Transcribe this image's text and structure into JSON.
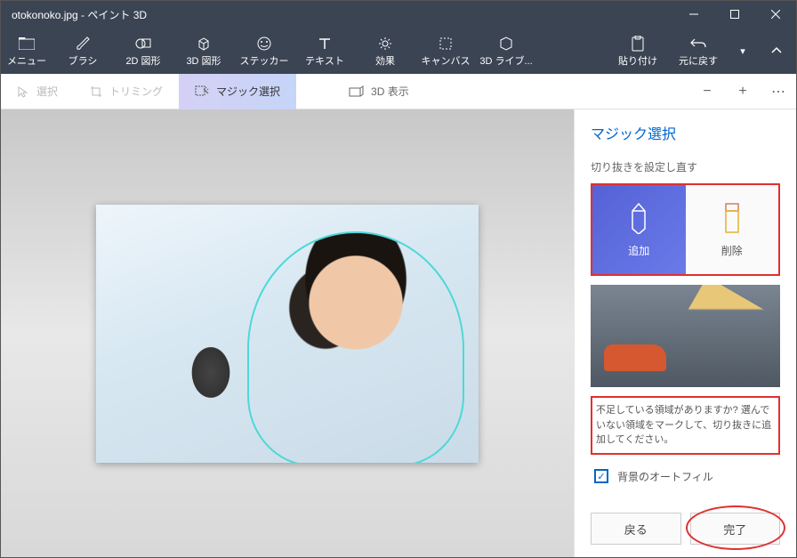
{
  "title": "otokonoko.jpg - ペイント 3D",
  "ribbon": {
    "menu": "メニュー",
    "items": [
      "ブラシ",
      "2D 図形",
      "3D 図形",
      "ステッカー",
      "テキスト",
      "効果",
      "キャンバス",
      "3D ライブ..."
    ],
    "paste": "貼り付け",
    "undo": "元に戻す"
  },
  "toolbar": {
    "select": "選択",
    "trim": "トリミング",
    "magic": "マジック選択",
    "view3d": "3D 表示"
  },
  "panel": {
    "title": "マジック選択",
    "sub": "切り抜きを設定し直す",
    "add": "追加",
    "remove": "削除",
    "hint": "不足している領域がありますか? 選んでいない領域をマークして、切り抜きに追加してください。",
    "autofill": "背景のオートフィル",
    "back": "戻る",
    "done": "完了"
  }
}
